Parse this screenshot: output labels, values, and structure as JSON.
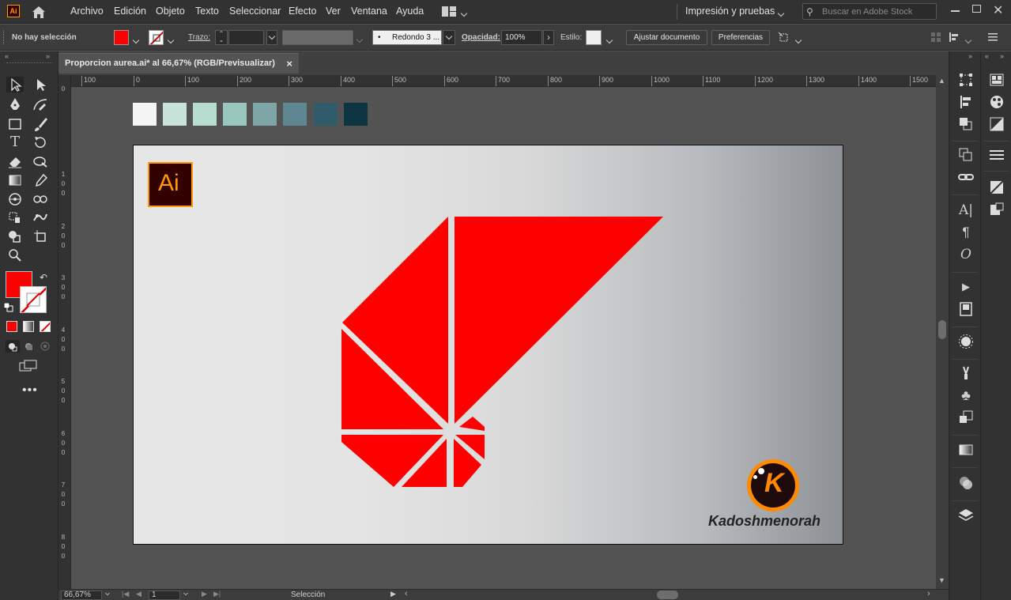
{
  "app": {
    "logo_text": "Ai"
  },
  "menu": {
    "items": [
      "Archivo",
      "Edición",
      "Objeto",
      "Texto",
      "Seleccionar",
      "Efecto",
      "Ver",
      "Ventana",
      "Ayuda"
    ],
    "workspace": "Impresión y pruebas",
    "stock_search_placeholder": "Buscar en Adobe Stock"
  },
  "control": {
    "selection_status": "No hay selección",
    "stroke_label": "Trazo:",
    "brush_label": "Redondo 3 ...",
    "opacity_label": "Opacidad:",
    "opacity_value": "100%",
    "style_label": "Estilo:",
    "adjust_doc_button": "Ajustar documento",
    "preferences_button": "Preferencias"
  },
  "document": {
    "tab_title": "Proporcion aurea.ai* al 66,67% (RGB/Previsualizar)",
    "close_glyph": "×"
  },
  "ruler": {
    "h_labels": [
      "100",
      "0",
      "100",
      "200",
      "300",
      "400",
      "500",
      "600",
      "700",
      "800",
      "900",
      "1000",
      "1100",
      "1200",
      "1300",
      "1400",
      "1500"
    ],
    "v_labels": [
      "0",
      "1 0 0",
      "2 0 0",
      "3 0 0",
      "4 0 0",
      "5 0 0",
      "6 0 0",
      "7 0 0",
      "8 0 0"
    ]
  },
  "swatches": [
    "#f4f4f4",
    "#c8e3d9",
    "#b7ddd1",
    "#99c6bd",
    "#7fa6a7",
    "#5e8792",
    "#2f5b6a",
    "#0d3441"
  ],
  "artboard": {
    "ai_badge_text": "Ai",
    "brand_mark": "K",
    "brand_name": "Kadoshmenorah",
    "shape_color": "#ff0000"
  },
  "tools": {
    "fill_color": "#ff0000",
    "stroke_color": "none"
  },
  "status": {
    "zoom": "66,67%",
    "artboard_number": "1",
    "mode": "Selección"
  }
}
